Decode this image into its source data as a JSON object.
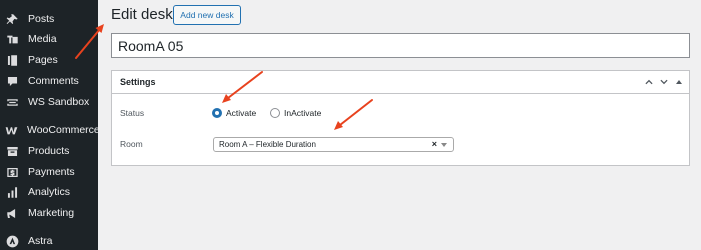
{
  "sidebar": {
    "items": [
      {
        "label": "Posts",
        "icon": "pin-icon"
      },
      {
        "label": "Media",
        "icon": "media-icon"
      },
      {
        "label": "Pages",
        "icon": "pages-icon"
      },
      {
        "label": "Comments",
        "icon": "comment-icon"
      },
      {
        "label": "WS Sandbox",
        "icon": "sandbox-icon"
      },
      {
        "label": "WooCommerce",
        "icon": "woo-icon"
      },
      {
        "label": "Products",
        "icon": "archive-icon"
      },
      {
        "label": "Payments",
        "icon": "payments-icon"
      },
      {
        "label": "Analytics",
        "icon": "bar-chart-icon"
      },
      {
        "label": "Marketing",
        "icon": "megaphone-icon"
      },
      {
        "label": "Astra",
        "icon": "astra-icon"
      }
    ]
  },
  "header": {
    "title": "Edit desk",
    "add_new_label": "Add new desk"
  },
  "title_field": {
    "value": "RoomA 05"
  },
  "settings_panel": {
    "title": "Settings",
    "status": {
      "label": "Status",
      "options": [
        {
          "label": "Activate",
          "checked": true
        },
        {
          "label": "InActivate",
          "checked": false
        }
      ]
    },
    "room": {
      "label": "Room",
      "selected": "Room A – Flexible Duration",
      "clear_symbol": "×"
    }
  },
  "colors": {
    "sidebar_bg": "#1d2327",
    "accent": "#2271b1",
    "annotation_arrow": "#e8421e"
  }
}
